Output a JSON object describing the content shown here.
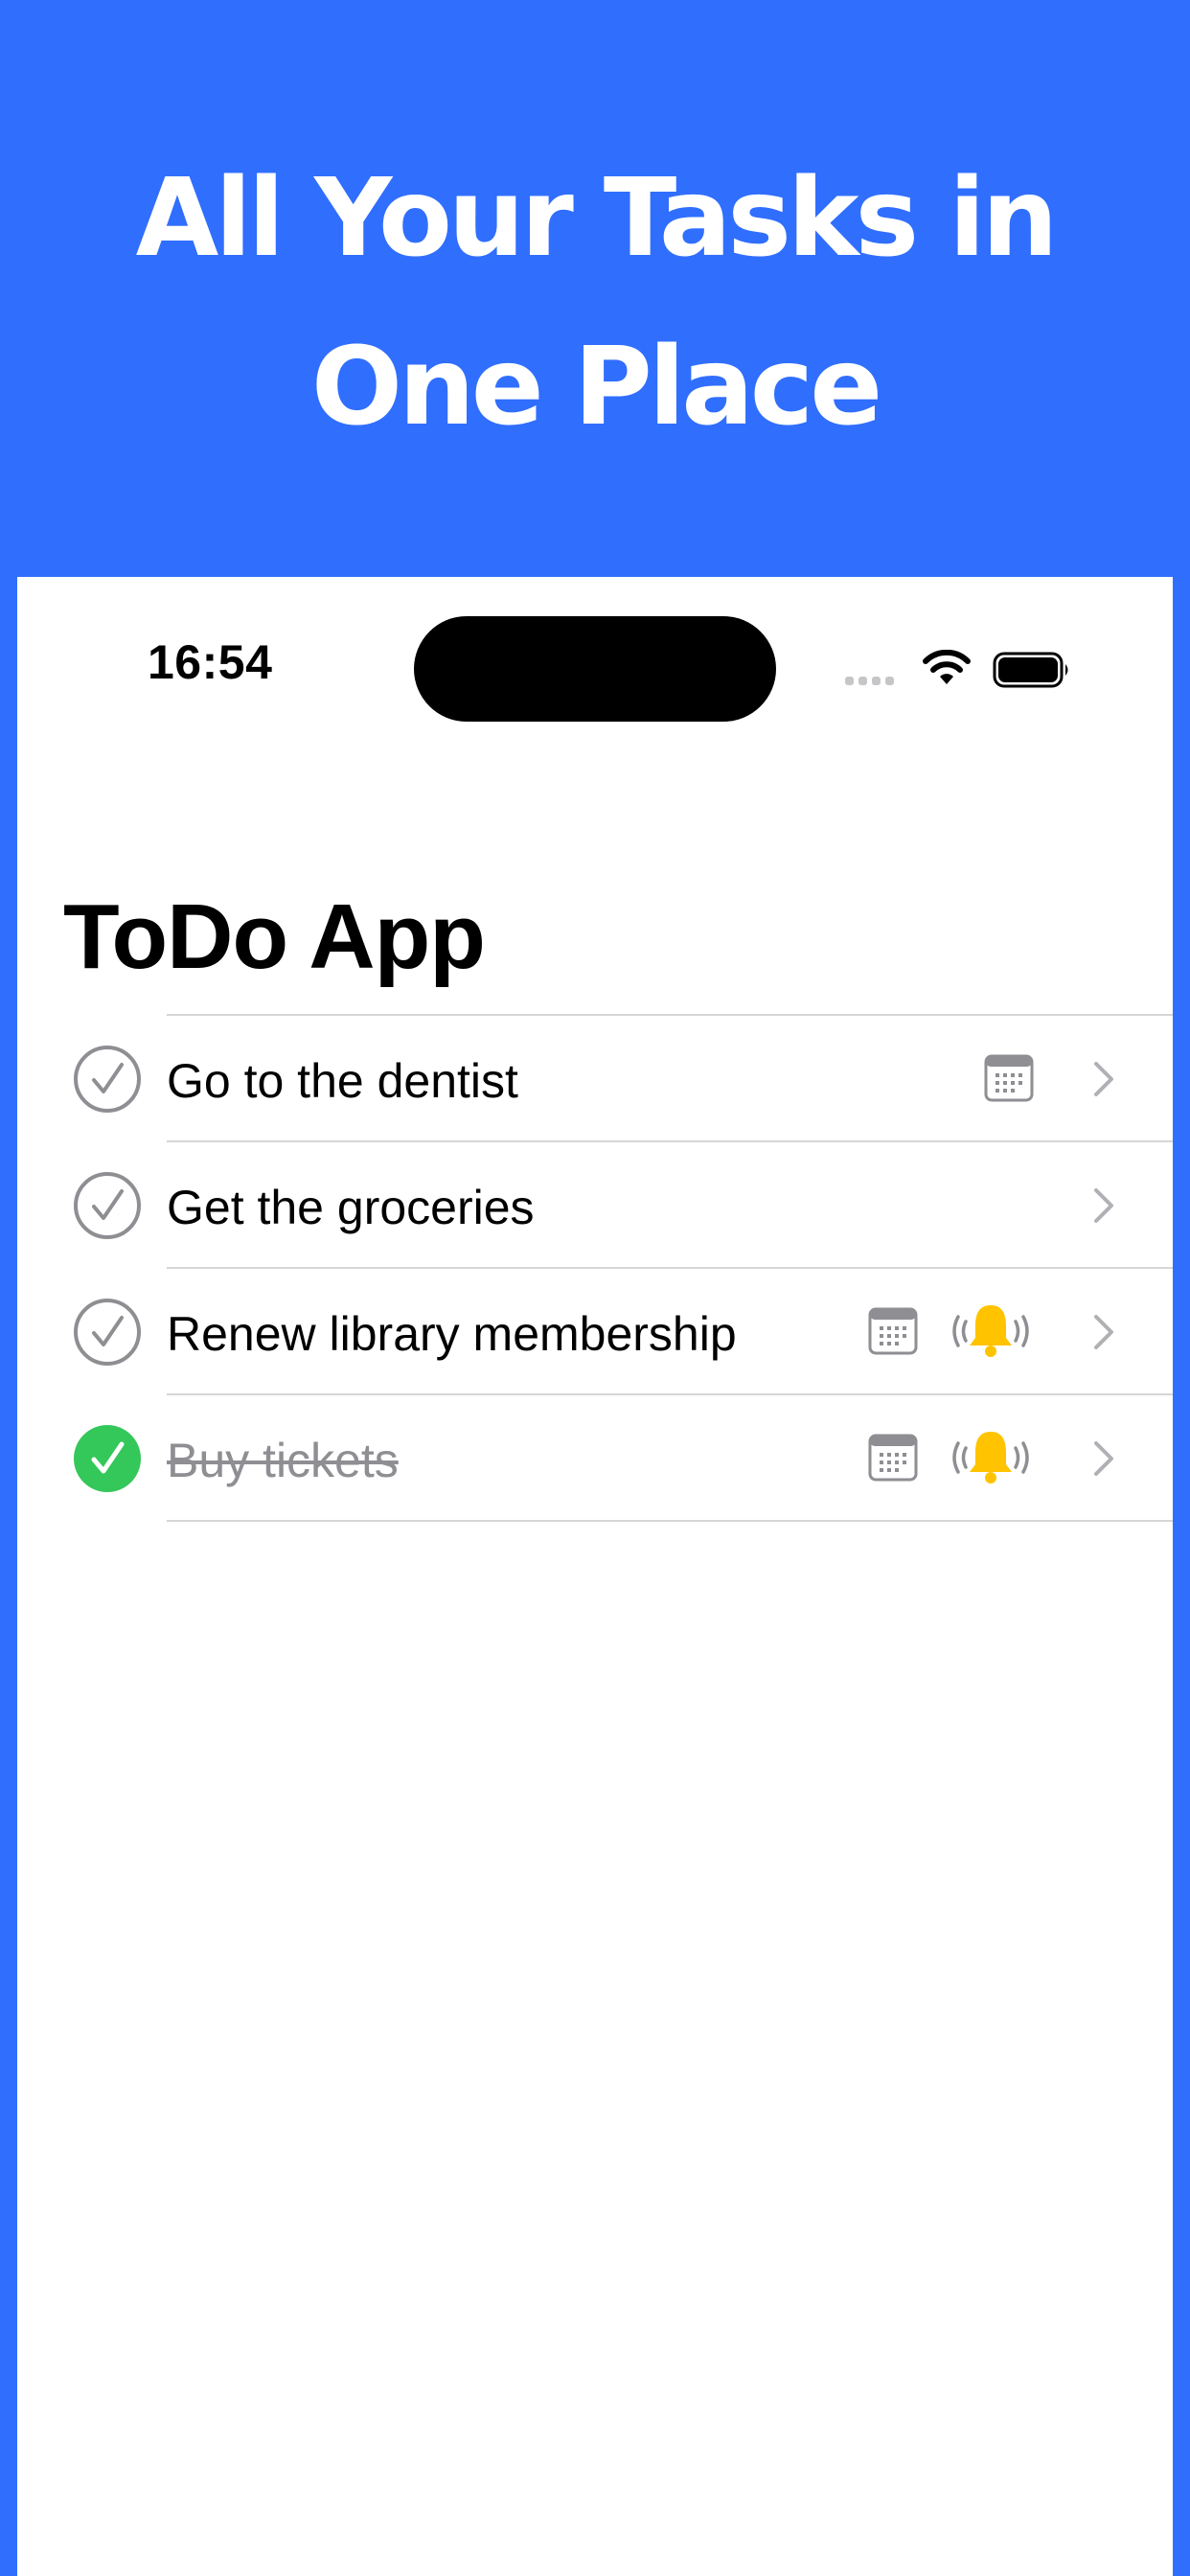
{
  "promo": {
    "headline_line1": "All Your Tasks in",
    "headline_line2": "One Place",
    "background_color": "#306EFE"
  },
  "status_bar": {
    "time": "16:54",
    "icons": [
      "cellular-signal-icon",
      "wifi-icon",
      "battery-icon"
    ]
  },
  "app": {
    "title": "ToDo App"
  },
  "tasks": [
    {
      "title": "Go to the dentist",
      "completed": false,
      "has_date": true,
      "has_reminder": false
    },
    {
      "title": "Get the groceries",
      "completed": false,
      "has_date": false,
      "has_reminder": false
    },
    {
      "title": "Renew library membership",
      "completed": false,
      "has_date": true,
      "has_reminder": true
    },
    {
      "title": "Buy tickets",
      "completed": true,
      "has_date": true,
      "has_reminder": true
    }
  ],
  "colors": {
    "accent_blue": "#306EFE",
    "completed_green": "#34C759",
    "reminder_yellow": "#FFC300",
    "secondary_gray": "#8E8E93"
  }
}
